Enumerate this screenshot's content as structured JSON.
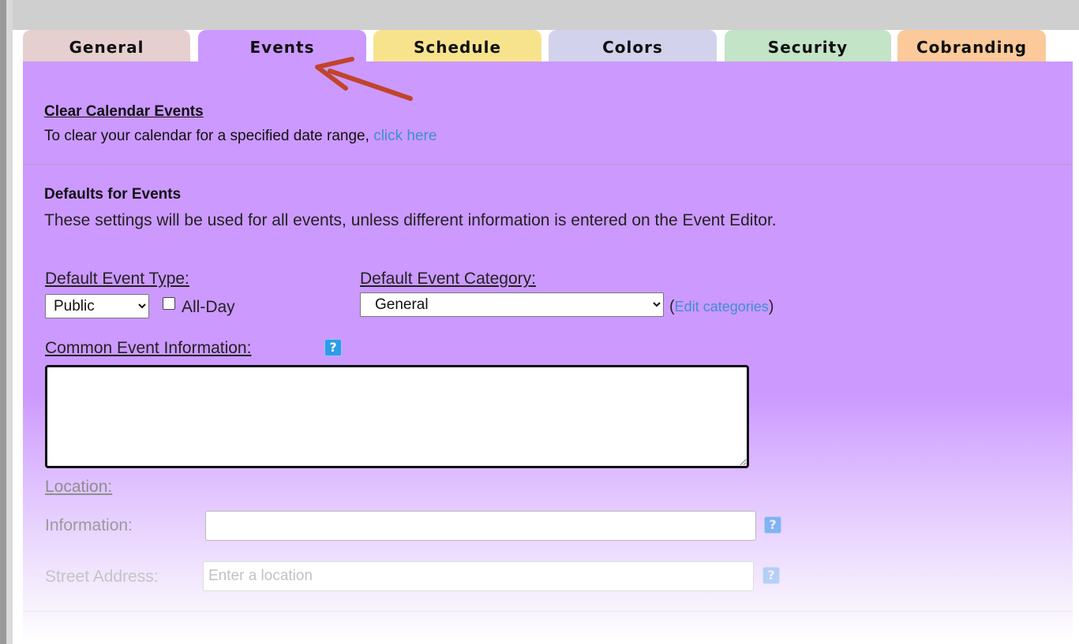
{
  "tabs": [
    {
      "label": "General",
      "color": "#e6d0cf"
    },
    {
      "label": "Events",
      "color": "#cc99ff",
      "active": true
    },
    {
      "label": "Schedule",
      "color": "#f8e38d"
    },
    {
      "label": "Colors",
      "color": "#d2d2ec"
    },
    {
      "label": "Security",
      "color": "#c3e4c7"
    },
    {
      "label": "Cobranding",
      "color": "#fbc99a"
    }
  ],
  "clear_section": {
    "title": "Clear Calendar Events",
    "description": "To clear your calendar for a specified date range,",
    "link": "click here"
  },
  "defaults_section": {
    "title": "Defaults for Events",
    "description": "These settings will be used for all events, unless different information is entered on the Event Editor."
  },
  "event_type": {
    "label": "Default Event Type:",
    "selected": "Public",
    "allday_label": "All-Day",
    "allday_checked": false
  },
  "event_category": {
    "label": "Default Event Category:",
    "selected": "General",
    "edit_link": "Edit categories",
    "paren_open": "(",
    "paren_close": ")"
  },
  "common_info": {
    "label": "Common Event Information:",
    "value": ""
  },
  "location": {
    "label": "Location:",
    "information_label": "Information:",
    "information_value": "",
    "street_label": "Street Address:",
    "street_placeholder": "Enter a location"
  },
  "help_glyph": "?",
  "colors": {
    "panel": "#cc99ff",
    "link": "#3f8fd0",
    "help": "#2f9be9",
    "arrow": "#c0442b"
  },
  "icons": [
    "chevron-down-icon",
    "question-mark-icon",
    "red-arrow-annotation"
  ]
}
